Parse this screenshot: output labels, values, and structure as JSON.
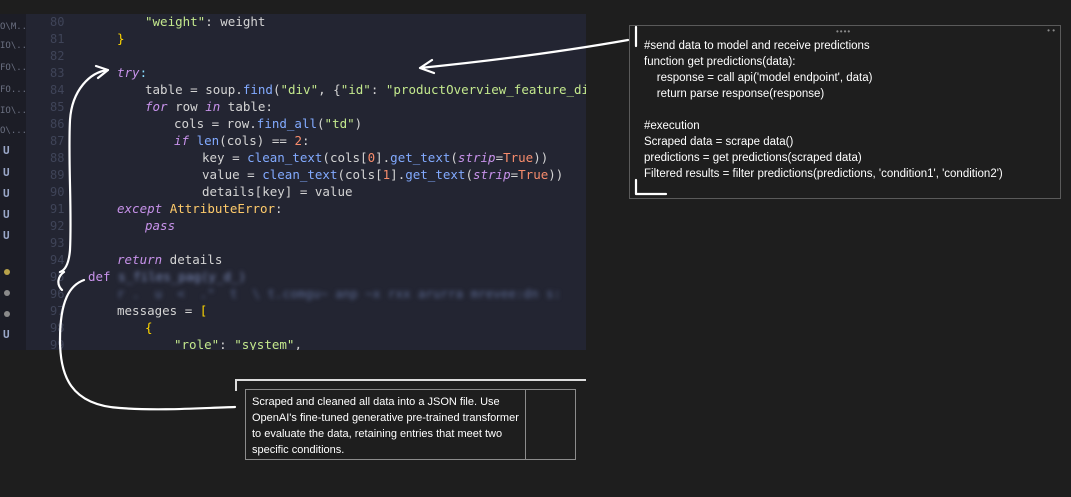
{
  "explorer": {
    "fragments": [
      "O\\M...",
      "IO\\...",
      "FO\\...",
      "FO...",
      "IO\\...",
      "O\\..."
    ],
    "badges": [
      "U",
      "U",
      "U",
      "U",
      "U",
      "U",
      "U"
    ],
    "dot_colors": [
      "#b8a24a",
      "#8a8a8a",
      "#8a8a8a"
    ]
  },
  "editor": {
    "line_numbers": [
      "80",
      "81",
      "82",
      "83",
      "84",
      "85",
      "86",
      "87",
      "88",
      "89",
      "90",
      "91",
      "92",
      "93",
      "94",
      "95",
      "96",
      "97",
      "98",
      "99"
    ],
    "lines": {
      "l0_key": "\"weight\"",
      "l0_rest": ": weight",
      "l1": "}",
      "l3_try": "try",
      "l3_colon": ":",
      "l4_a": "table = soup.",
      "l4_fn": "find",
      "l4_b": "(",
      "l4_s1": "\"div\"",
      "l4_c": ", {",
      "l4_s2": "\"id\"",
      "l4_d": ": ",
      "l4_s3": "\"productOverview_feature_div\"",
      "l4_e": "})",
      "l5_for": "for",
      "l5_a": " row ",
      "l5_in": "in",
      "l5_b": " table:",
      "l6_a": "cols = row.",
      "l6_fn": "find_all",
      "l6_b": "(",
      "l6_s": "\"td\"",
      "l6_c": ")",
      "l7_if": "if",
      "l7_fn": "len",
      "l7_a": "(cols) == ",
      "l7_num": "2",
      "l7_b": ":",
      "l8_a": "key = ",
      "l8_fn": "clean_text",
      "l8_b": "(cols[",
      "l8_num": "0",
      "l8_c": "].",
      "l8_fn2": "get_text",
      "l8_d": "(",
      "l8_p": "strip",
      "l8_e": "=",
      "l8_t": "True",
      "l8_f": "))",
      "l9_a": "value = ",
      "l9_fn": "clean_text",
      "l9_b": "(cols[",
      "l9_num": "1",
      "l9_c": "].",
      "l9_fn2": "get_text",
      "l9_d": "(",
      "l9_p": "strip",
      "l9_e": "=",
      "l9_t": "True",
      "l9_f": "))",
      "l10": "details[key] = value",
      "l11_except": "except",
      "l11_cls": "AttributeError",
      "l11_b": ":",
      "l12": "pass",
      "l14_ret": "return",
      "l14_b": " details",
      "l15_def": "def",
      "l15_blur": "s_files_pag(y_d_)",
      "l16_blur": "r .  u  <  .\"  t  \\ t.comgu~ anp ~x rxx arurra mrevee:dn s:",
      "l17_a": "messages = ",
      "l17_b": "[",
      "l18": "{",
      "l19_s1": "\"role\"",
      "l19_a": ": ",
      "l19_s2": "\"system\"",
      "l19_b": ","
    }
  },
  "popup": {
    "lines": [
      "#send data to model and receive predictions",
      "function get predictions(data):",
      "    response = call api('model endpoint', data)",
      "    return parse response(response)",
      "",
      "#execution",
      "Scraped data = scrape data()",
      "predictions = get predictions(scraped data)",
      "Filtered results = filter predictions(predictions, 'condition1', 'condition2')"
    ]
  },
  "note": {
    "text": "Scraped and cleaned all data into a JSON file. Use OpenAI's fine-tuned generative pre-trained transformer to evaluate the data, retaining entries that meet two specific conditions."
  }
}
